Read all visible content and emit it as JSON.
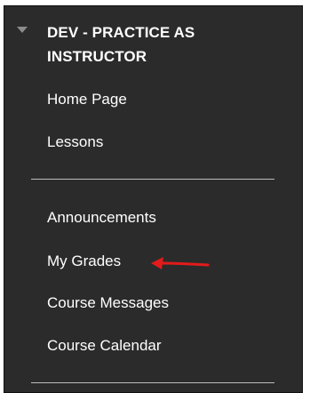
{
  "course": {
    "title": "DEV - PRACTICE AS INSTRUCTOR",
    "collapse_icon": "caret-down-icon"
  },
  "menu": {
    "group1": [
      {
        "label": "Home Page"
      },
      {
        "label": "Lessons"
      }
    ],
    "group2": [
      {
        "label": "Announcements"
      },
      {
        "label": "My Grades"
      },
      {
        "label": "Course Messages"
      },
      {
        "label": "Course Calendar"
      }
    ]
  },
  "annotation": {
    "icon": "red-arrow-icon",
    "color": "#e21b1b"
  },
  "colors": {
    "panel_bg": "#2b2b2b",
    "text": "#ffffff",
    "divider": "#bdbdbd"
  }
}
